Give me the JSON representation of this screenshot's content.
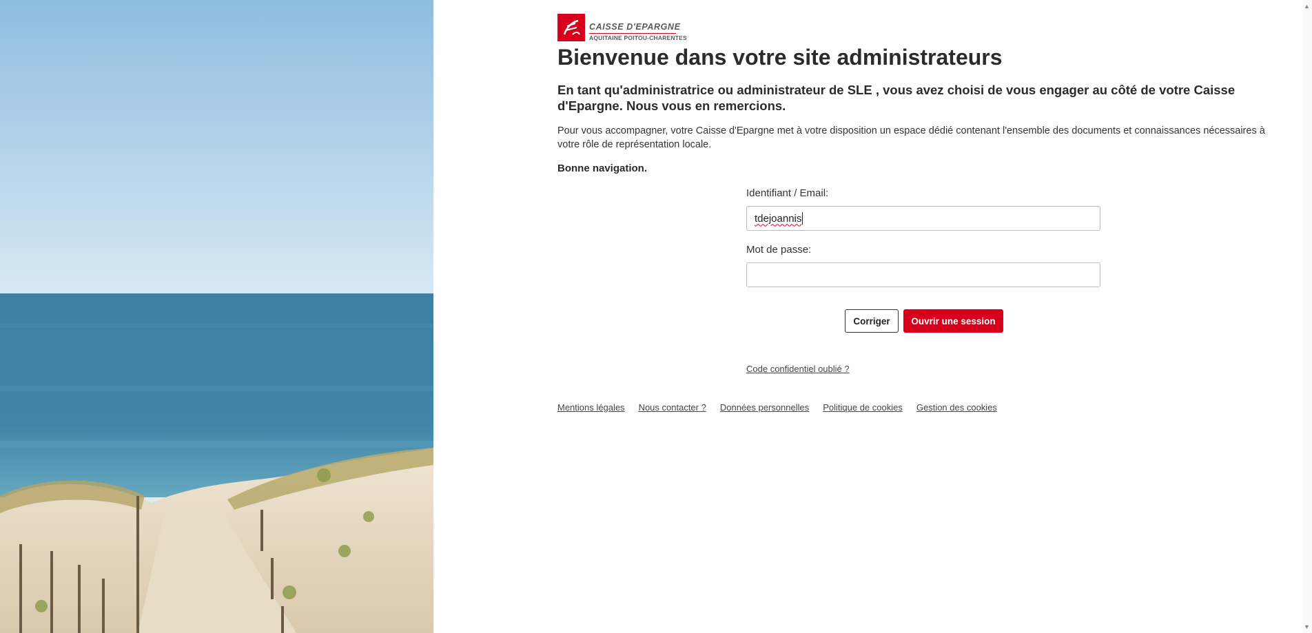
{
  "brand": {
    "name": "CAISSE D'EPARGNE",
    "region": "AQUITAINE POITOU-CHARENTES",
    "color": "#d6001c"
  },
  "header": {
    "title": "Bienvenue dans votre site administrateurs"
  },
  "intro": {
    "lead": "En tant qu'administratrice ou administrateur de SLE , vous avez choisi de vous engager au côté de votre Caisse d'Epargne. Nous vous en remercions.",
    "description": "Pour vous accompagner, votre Caisse d'Epargne met à votre disposition un espace dédié contenant l'ensemble des documents et connaissances nécessaires à votre rôle de représentation locale.",
    "closing": "Bonne navigation."
  },
  "login": {
    "identifier_label": "Identifiant / Email:",
    "identifier_value": "tdejoannis",
    "password_label": "Mot de passe:",
    "password_value": "",
    "reset_label": "Corriger",
    "submit_label": "Ouvrir une session",
    "forgot_label": "Code confidentiel oublié ?"
  },
  "footer": {
    "links": [
      "Mentions légales",
      "Nous contacter ?",
      "Données personnelles",
      "Politique de cookies",
      "Gestion des cookies"
    ]
  },
  "icons": {
    "logo": "squirrel-logo-icon",
    "scroll_up": "chevron-up-icon",
    "scroll_down": "chevron-down-icon"
  }
}
